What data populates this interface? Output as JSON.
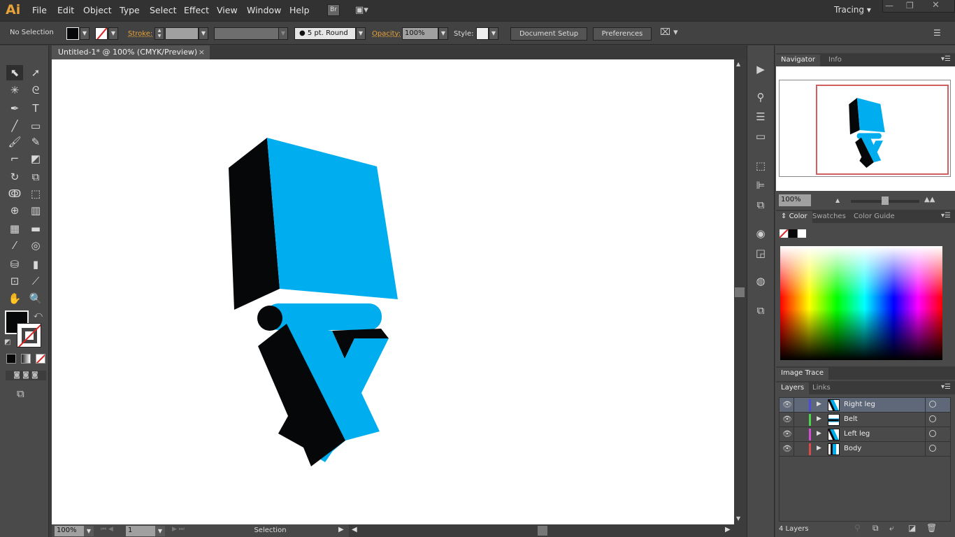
{
  "app": {
    "logo": "Ai",
    "menus": [
      "File",
      "Edit",
      "Object",
      "Type",
      "Select",
      "Effect",
      "View",
      "Window",
      "Help"
    ],
    "bridge": "Br",
    "workspace": "Tracing"
  },
  "control": {
    "selection": "No Selection",
    "stroke_label": "Stroke:",
    "brush": "5 pt. Round",
    "opacity_label": "Opacity:",
    "opacity": "100%",
    "style_label": "Style:",
    "document_setup": "Document Setup",
    "preferences": "Preferences"
  },
  "document": {
    "tab": "Untitled-1* @ 100% (CMYK/Preview)"
  },
  "tools": [
    "selection",
    "direct-selection",
    "magic-wand",
    "lasso",
    "pen",
    "type",
    "line",
    "rectangle",
    "paintbrush",
    "pencil",
    "blob-brush",
    "eraser",
    "rotate",
    "scale",
    "warp",
    "free-transform",
    "shape-builder",
    "perspective-grid",
    "mesh",
    "gradient",
    "eyedropper",
    "blend",
    "symbol-sprayer",
    "column-graph",
    "artboard",
    "slice",
    "hand",
    "zoom"
  ],
  "status": {
    "zoom": "100%",
    "page": "1",
    "tool": "Selection"
  },
  "navigator": {
    "tabs": [
      "Navigator",
      "Info"
    ],
    "zoom": "100%"
  },
  "color": {
    "tabs": [
      "Color",
      "Swatches",
      "Color Guide"
    ],
    "fill": "#050708",
    "accent_blue": "#00aeef"
  },
  "image_trace": {
    "title": "Image Trace"
  },
  "layers": {
    "tabs": [
      "Layers",
      "Links"
    ],
    "items": [
      {
        "name": "Right leg",
        "color": "#4b4bdc",
        "selected": true
      },
      {
        "name": "Belt",
        "color": "#4cd44c"
      },
      {
        "name": "Left leg",
        "color": "#d44cd4"
      },
      {
        "name": "Body",
        "color": "#dc4b4b"
      }
    ],
    "count": "4 Layers"
  }
}
